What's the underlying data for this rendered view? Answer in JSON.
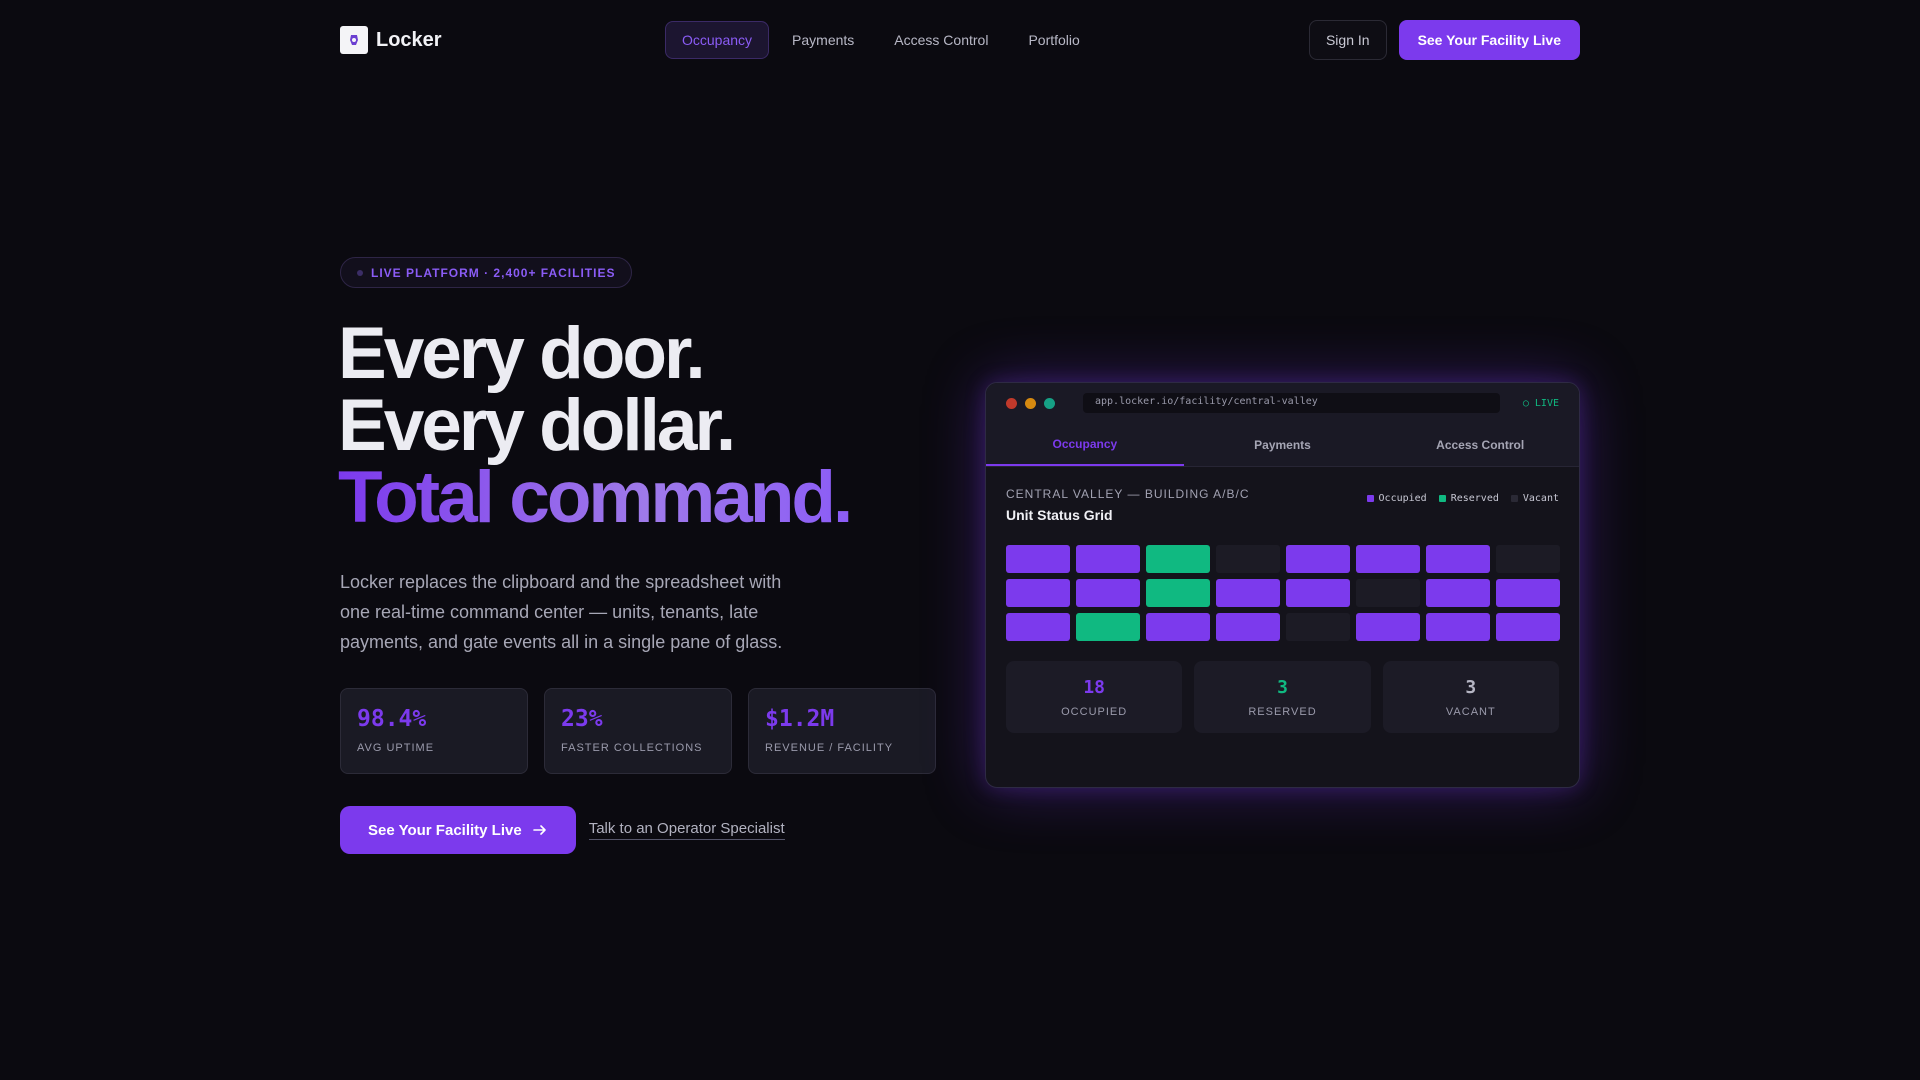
{
  "nav": {
    "brand": "Locker",
    "links": [
      "Occupancy",
      "Payments",
      "Access Control",
      "Portfolio"
    ],
    "active_link": "Occupancy",
    "sign_in": "Sign In",
    "cta": "See Your Facility Live"
  },
  "hero": {
    "badge": "LIVE PLATFORM · 2,400+ FACILITIES",
    "headline": [
      "Every door.",
      "Every dollar.",
      "Total command."
    ],
    "lede": "Locker replaces the clipboard and the spreadsheet with one real-time command center — units, tenants, late payments, and gate events all in a single pane of glass.",
    "stats": [
      {
        "value": "98.4%",
        "label": "AVG UPTIME"
      },
      {
        "value": "23%",
        "label": "FASTER COLLECTIONS"
      },
      {
        "value": "$1.2M",
        "label": "REVENUE / FACILITY"
      }
    ],
    "cta_primary": "See Your Facility Live",
    "cta_secondary": "Talk to an Operator Specialist"
  },
  "mock": {
    "url": "app.locker.io/facility/central-valley",
    "live": "LIVE",
    "tabs": [
      "Occupancy",
      "Payments",
      "Access Control"
    ],
    "active_tab": "Occupancy",
    "location": "CENTRAL VALLEY — BUILDING A/B/C",
    "grid_title": "Unit Status Grid",
    "legend": [
      {
        "label": "Occupied",
        "color": "#7c3aed"
      },
      {
        "label": "Reserved",
        "color": "#10b981"
      },
      {
        "label": "Vacant",
        "color": "#1c1b25"
      }
    ],
    "units": [
      [
        "occupied",
        "occupied",
        "reserved",
        "vacant",
        "occupied",
        "occupied",
        "occupied",
        "vacant"
      ],
      [
        "occupied",
        "occupied",
        "reserved",
        "occupied",
        "occupied",
        "vacant",
        "occupied",
        "occupied"
      ],
      [
        "occupied",
        "reserved",
        "occupied",
        "occupied",
        "vacant",
        "occupied",
        "occupied",
        "occupied"
      ]
    ],
    "counts": [
      {
        "value": "18",
        "label": "OCCUPIED",
        "color": "#7c3aed"
      },
      {
        "value": "3",
        "label": "RESERVED",
        "color": "#10b981"
      },
      {
        "value": "3",
        "label": "VACANT",
        "color": "#b5b5c3"
      }
    ]
  },
  "colors": {
    "accent": "#7c3aed",
    "reserved": "#10b981",
    "background": "#0b0a10"
  }
}
